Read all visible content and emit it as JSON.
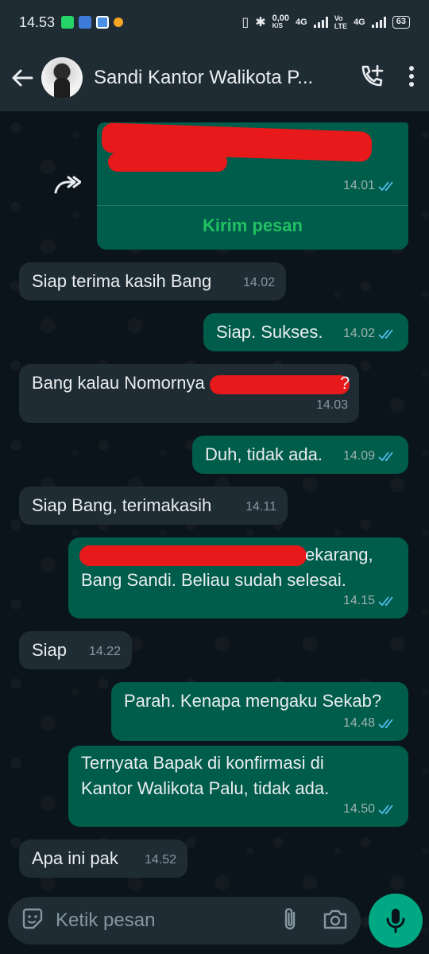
{
  "status_bar": {
    "time": "14.53",
    "net_speed_top": "0,00",
    "net_speed_unit": "K/S",
    "net_type_1": "4G",
    "net_type_2": "Vo\nLTE",
    "net_type_3": "4G",
    "battery": "63"
  },
  "header": {
    "contact_name": "Sandi Kantor Walikota P...",
    "icons": [
      "back-arrow-icon",
      "add-call-icon",
      "more-vert-icon"
    ]
  },
  "messages": [
    {
      "id": "m1",
      "direction": "out",
      "type": "forwarded-contact",
      "time": "14.01",
      "action": "Kirim pesan",
      "text": ""
    },
    {
      "id": "m2",
      "direction": "in",
      "text": "Siap terima kasih Bang",
      "time": "14.02"
    },
    {
      "id": "m3",
      "direction": "out",
      "text": "Siap. Sukses.",
      "time": "14.02"
    },
    {
      "id": "m4",
      "direction": "in",
      "text_before": "Bang kalau Nomornya",
      "text_after": "?",
      "time": "14.03"
    },
    {
      "id": "m5",
      "direction": "out",
      "text": "Duh, tidak ada.",
      "time": "14.09"
    },
    {
      "id": "m6",
      "direction": "in",
      "text": "Siap Bang, terimakasih",
      "time": "14.11"
    },
    {
      "id": "m7",
      "direction": "out",
      "line1_visible": "ekarang,",
      "line2": "Bang Sandi. Beliau sudah selesai.",
      "time": "14.15"
    },
    {
      "id": "m8",
      "direction": "in",
      "text": "Siap",
      "time": "14.22"
    },
    {
      "id": "m9",
      "direction": "out",
      "text": "Parah. Kenapa mengaku Sekab?",
      "time": "14.48"
    },
    {
      "id": "m10",
      "direction": "out",
      "line1": "Ternyata Bapak di konfirmasi di",
      "line2": "Kantor Walikota Palu, tidak ada.",
      "time": "14.50"
    },
    {
      "id": "m11",
      "direction": "in",
      "text": "Apa ini pak",
      "time": "14.52"
    }
  ],
  "input": {
    "placeholder": "Ketik pesan",
    "icons": [
      "emoji-icon",
      "attach-icon",
      "camera-icon",
      "mic-icon"
    ]
  },
  "colors": {
    "incoming_bubble": "#1f2c34",
    "outgoing_bubble": "#005c4b",
    "accent": "#00a884",
    "read_ticks": "#53bdeb",
    "redaction": "#e8191a"
  }
}
